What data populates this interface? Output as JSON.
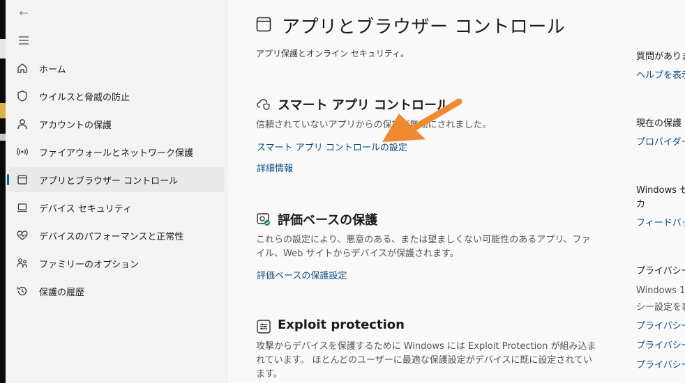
{
  "window": {
    "back_glyph": "←"
  },
  "sidebar": {
    "items": [
      {
        "label": "ホーム",
        "icon": "home-icon"
      },
      {
        "label": "ウイルスと脅威の防止",
        "icon": "shield-icon"
      },
      {
        "label": "アカウントの保護",
        "icon": "person-icon"
      },
      {
        "label": "ファイアウォールとネットワーク保護",
        "icon": "wifi-antenna-icon"
      },
      {
        "label": "アプリとブラウザー コントロール",
        "icon": "app-window-icon",
        "active": true
      },
      {
        "label": "デバイス セキュリティ",
        "icon": "laptop-icon"
      },
      {
        "label": "デバイスのパフォーマンスと正常性",
        "icon": "heart-pulse-icon"
      },
      {
        "label": "ファミリーのオプション",
        "icon": "family-icon"
      },
      {
        "label": "保護の履歴",
        "icon": "history-icon"
      }
    ]
  },
  "main": {
    "title": "アプリとブラウザー コントロール",
    "subtitle": "アプリ保護とオンライン セキュリティ。",
    "smart_app": {
      "title": "スマート アプリ コントロール",
      "desc": "信頼されていないアプリからの保護が無効にされました。",
      "link_settings": "スマート アプリ コントロールの設定",
      "link_details": "詳細情報"
    },
    "reputation": {
      "title": "評価ベースの保護",
      "desc": "これらの設定により、悪意のある、または望ましくない可能性のあるアプリ、ファイル、Web サイトからデバイスが保護されます。",
      "link": "評価ベースの保護設定"
    },
    "exploit": {
      "title": "Exploit protection",
      "desc": "攻撃からデバイスを保護するために Windows には Exploit Protection が組み込まれています。 ほとんどのユーザーに最適な保護設定がデバイスに既に設定されています。"
    }
  },
  "right_panel": {
    "q_title": "質問がありま",
    "q_link": "ヘルプを表示",
    "provider_title": "現在の保護",
    "provider_link": "プロバイダーの",
    "feedback_title_1": "Windows セ",
    "feedback_title_2": "カ",
    "feedback_link": "フィードバック",
    "privacy_title": "プライバシーの",
    "privacy_desc_1": "Windows 1",
    "privacy_desc_2": "シー設定を表",
    "privacy_link_1": "プライバシーの",
    "privacy_link_2": "プライバシー ダ",
    "privacy_link_3": "プライバシーに"
  },
  "colors": {
    "accent": "#005fb8",
    "link": "#0a4a86",
    "annotation_arrow": "#ef8a32"
  }
}
